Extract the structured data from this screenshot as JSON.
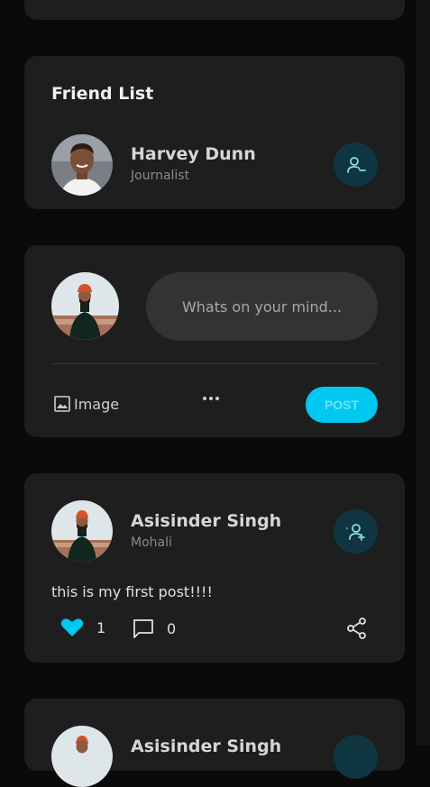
{
  "friend_list": {
    "title": "Friend List",
    "friends": [
      {
        "name": "Harvey Dunn",
        "subtitle": "Journalist",
        "action_icon": "remove-friend-icon"
      }
    ]
  },
  "composer": {
    "placeholder": "Whats on your mind...",
    "image_label": "Image",
    "more_icon": "more-icon",
    "post_label": "POST"
  },
  "posts": [
    {
      "author": "Asisinder Singh",
      "location": "Mohali",
      "text": "this is my first post!!!!",
      "likes": "1",
      "comments": "0",
      "liked": true,
      "action_icon": "add-friend-icon"
    },
    {
      "author": "Asisinder Singh"
    }
  ],
  "colors": {
    "accent": "#00c8ef",
    "card": "#1e1e1e",
    "background": "#0a0a0a",
    "icon_button_bg": "#0e3540"
  }
}
